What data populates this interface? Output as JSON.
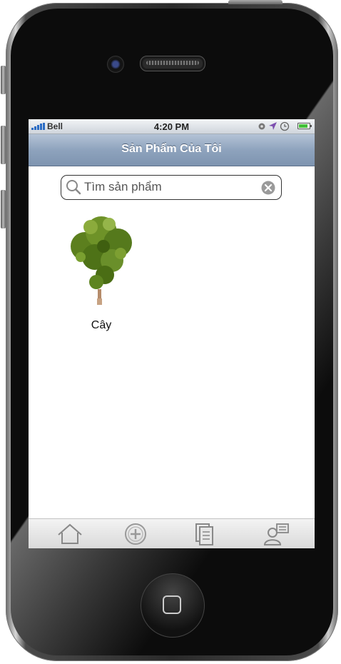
{
  "status_bar": {
    "carrier": "Bell",
    "time": "4:20 PM"
  },
  "nav_bar": {
    "title": "Sản Phẩm Của Tôi"
  },
  "search": {
    "placeholder": "Tìm sản phẩm",
    "value": ""
  },
  "products": [
    {
      "label": "Cây",
      "image_icon": "tree-image"
    }
  ],
  "tab_bar": {
    "tabs": [
      {
        "icon": "home-icon"
      },
      {
        "icon": "add-circle-icon"
      },
      {
        "icon": "documents-icon"
      },
      {
        "icon": "contacts-icon"
      }
    ]
  },
  "colors": {
    "nav_bar": "#8ea3bd",
    "battery_fill": "#45c03b",
    "signal_bars": "#2b6cc4"
  }
}
